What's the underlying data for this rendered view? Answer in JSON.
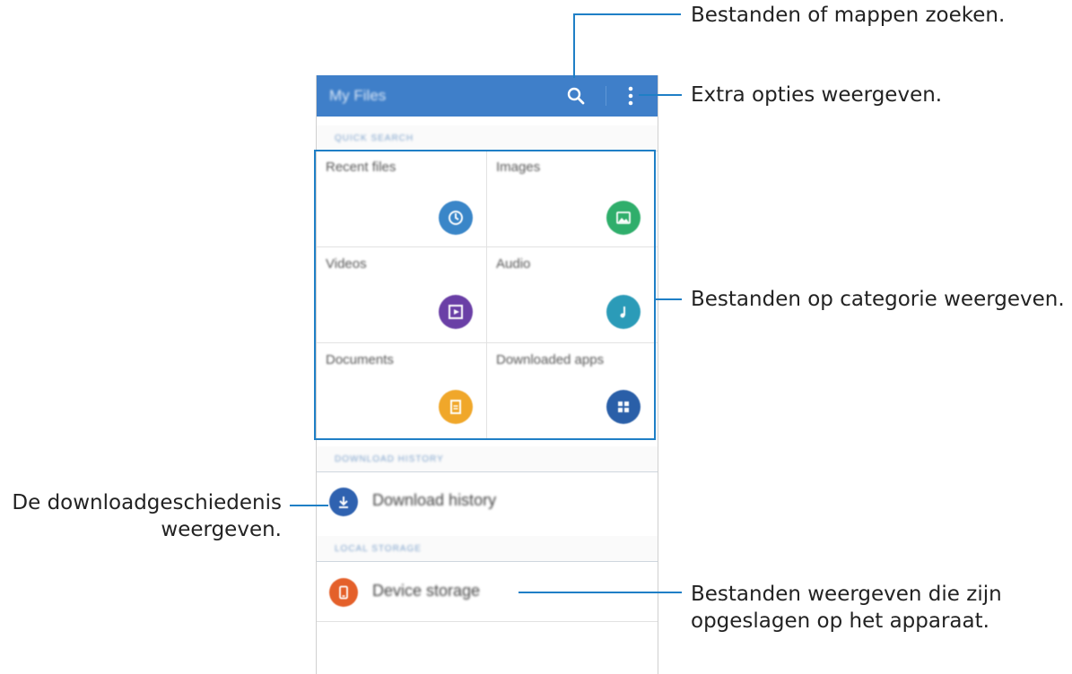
{
  "app": {
    "title": "My Files"
  },
  "sections": {
    "quick_search": "QUICK SEARCH",
    "download_history": "DOWNLOAD HISTORY",
    "local_storage": "LOCAL STORAGE"
  },
  "categories": [
    {
      "label": "Recent files",
      "icon": "clock-icon",
      "color": "#3a86c8"
    },
    {
      "label": "Images",
      "icon": "image-icon",
      "color": "#2fae6b"
    },
    {
      "label": "Videos",
      "icon": "video-icon",
      "color": "#6a3fa6"
    },
    {
      "label": "Audio",
      "icon": "music-icon",
      "color": "#2b9bb8"
    },
    {
      "label": "Documents",
      "icon": "document-icon",
      "color": "#f0a72a"
    },
    {
      "label": "Downloaded apps",
      "icon": "apps-icon",
      "color": "#2a5fa8"
    }
  ],
  "list_items": {
    "download_history": {
      "label": "Download history",
      "icon": "download-icon",
      "color": "#2f62b0"
    },
    "device_storage": {
      "label": "Device storage",
      "icon": "phone-icon",
      "color": "#e4602a"
    }
  },
  "callouts": {
    "search": "Bestanden of mappen zoeken.",
    "more_options": "Extra opties weergeven.",
    "categories": "Bestanden op categorie weergeven.",
    "download_history_line1": "De downloadgeschiedenis",
    "download_history_line2": "weergeven.",
    "device_storage_line1": "Bestanden weergeven die zijn",
    "device_storage_line2": "opgeslagen op het apparaat."
  },
  "colors": {
    "appbar": "#3f7fc9",
    "accent": "#1f7fc6"
  }
}
